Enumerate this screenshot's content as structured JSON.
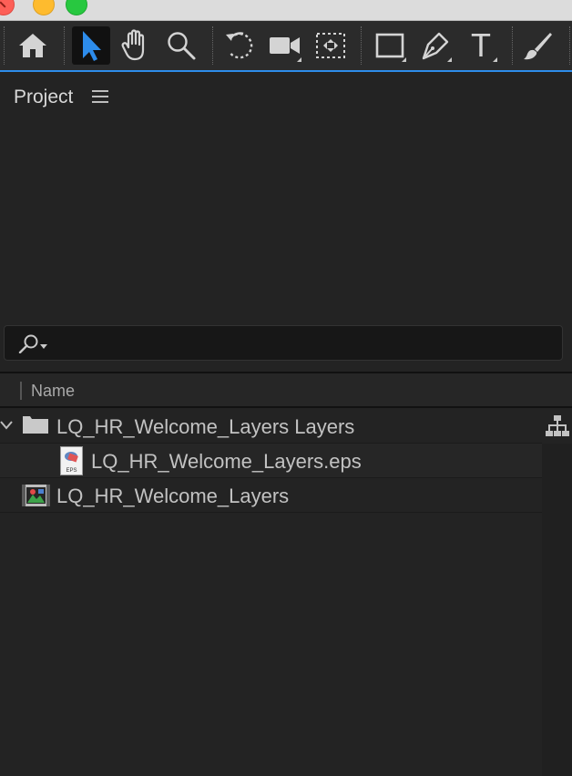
{
  "window": {
    "traffic_lights": [
      "close",
      "minimize",
      "maximize"
    ]
  },
  "toolbar": {
    "tools": [
      {
        "name": "home-icon"
      },
      {
        "name": "selection-tool-icon",
        "active": true
      },
      {
        "name": "hand-tool-icon"
      },
      {
        "name": "zoom-tool-icon"
      },
      {
        "name": "rotation-tool-icon"
      },
      {
        "name": "camera-tool-icon"
      },
      {
        "name": "pan-behind-tool-icon"
      },
      {
        "name": "rectangle-tool-icon"
      },
      {
        "name": "pen-tool-icon"
      },
      {
        "name": "type-tool-icon"
      },
      {
        "name": "brush-tool-icon"
      }
    ],
    "type_tool_glyph": "T",
    "accent_color": "#2d8ceb"
  },
  "project_panel": {
    "title": "Project",
    "menu_icon": "hamburger-menu-icon",
    "search": {
      "placeholder": "",
      "icon": "search-dropdown-icon"
    },
    "columns": [
      "Name"
    ],
    "items": [
      {
        "type": "folder",
        "label": "LQ_HR_Welcome_Layers Layers",
        "expanded": true,
        "icon": "folder-icon"
      },
      {
        "type": "eps",
        "label": "LQ_HR_Welcome_Layers.eps",
        "icon": "eps-file-icon",
        "icon_text": "EPS"
      },
      {
        "type": "composition",
        "label": "LQ_HR_Welcome_Layers",
        "icon": "composition-icon"
      }
    ],
    "flowchart_icon": "flowchart-icon"
  }
}
